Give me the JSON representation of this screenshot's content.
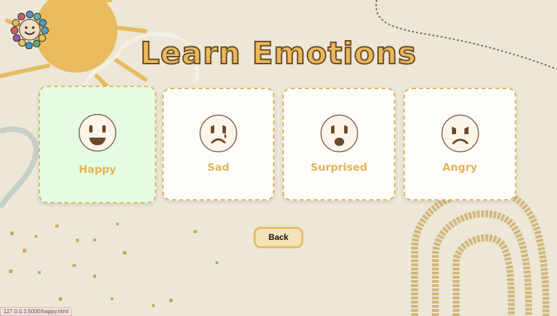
{
  "title": "Learn Emotions",
  "emotions": [
    {
      "label": "Happy",
      "face": "happy-face-icon",
      "active": true
    },
    {
      "label": "Sad",
      "face": "sad-face-icon",
      "active": false
    },
    {
      "label": "Surprised",
      "face": "surprised-face-icon",
      "active": false
    },
    {
      "label": "Angry",
      "face": "angry-face-icon",
      "active": false
    }
  ],
  "back_label": "Back",
  "status_url": "127.0.0.1:5000/happy.html",
  "colors": {
    "background": "#ece7d6",
    "accent": "#e3b45a",
    "active_card": "#e4fde0",
    "face_feature": "#6b4a2b"
  }
}
